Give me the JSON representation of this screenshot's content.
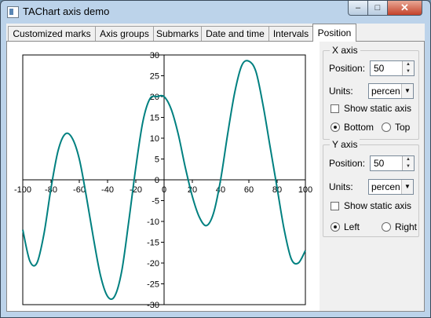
{
  "window": {
    "title": "TAChart axis demo",
    "minimize_glyph": "–",
    "maximize_glyph": "□",
    "close_glyph": "✕"
  },
  "tabs": [
    {
      "label": "Customized marks"
    },
    {
      "label": "Axis groups"
    },
    {
      "label": "Submarks"
    },
    {
      "label": "Date and time"
    },
    {
      "label": "Intervals"
    },
    {
      "label": "Position",
      "active": true
    }
  ],
  "x_axis_group": {
    "caption": "X axis",
    "position_label": "Position:",
    "position_value": "50",
    "units_label": "Units:",
    "units_value": "percen",
    "show_static_label": "Show static axis",
    "show_static_checked": false,
    "radio_bottom_label": "Bottom",
    "radio_top_label": "Top",
    "selected": "Bottom"
  },
  "y_axis_group": {
    "caption": "Y axis",
    "position_label": "Position:",
    "position_value": "50",
    "units_label": "Units:",
    "units_value": "percen",
    "show_static_label": "Show static axis",
    "show_static_checked": false,
    "radio_left_label": "Left",
    "radio_right_label": "Right",
    "selected": "Left"
  },
  "chart_data": {
    "type": "line",
    "xlim": [
      -100,
      100
    ],
    "ylim": [
      -30,
      30
    ],
    "x_ticks": [
      -100,
      -80,
      -60,
      -40,
      -20,
      0,
      20,
      40,
      60,
      80,
      100
    ],
    "y_ticks": [
      30,
      25,
      20,
      15,
      10,
      5,
      0,
      -5,
      -10,
      -15,
      -20,
      -25,
      -30
    ],
    "series": [
      {
        "color": "#008080",
        "x": [
          -100,
          -95,
          -90,
          -85,
          -80,
          -75,
          -70,
          -65,
          -60,
          -55,
          -50,
          -45,
          -40,
          -35,
          -30,
          -25,
          -20,
          -15,
          -10,
          -5,
          0,
          5,
          10,
          15,
          20,
          25,
          30,
          35,
          40,
          45,
          50,
          55,
          60,
          65,
          70,
          75,
          80,
          85,
          90,
          95,
          100
        ],
        "y": [
          -12,
          -19.5,
          -20,
          -13,
          -2,
          7,
          11,
          10,
          5,
          -4,
          -14,
          -23,
          -28,
          -28,
          -22,
          -10,
          3,
          14,
          19.5,
          20,
          20,
          17,
          11,
          3,
          -4,
          -9,
          -11,
          -8,
          0,
          11,
          21,
          27.5,
          28.5,
          26,
          18,
          8,
          -2,
          -12,
          -19,
          -20,
          -17
        ]
      }
    ],
    "grid": false,
    "legend": "none",
    "axes_cross_at": "center"
  }
}
